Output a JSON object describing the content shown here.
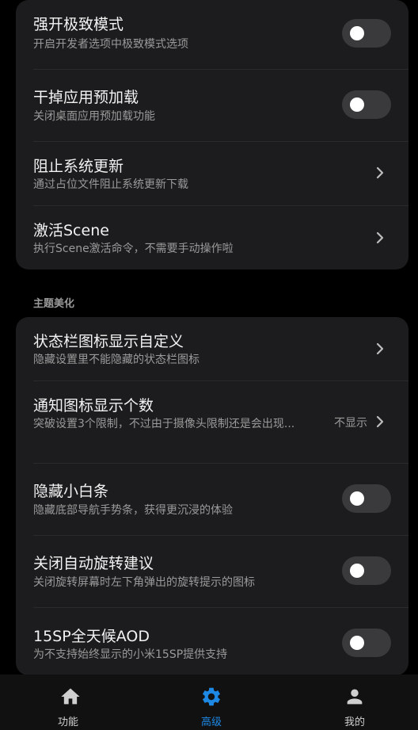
{
  "header_fragment": {
    "title": ""
  },
  "card1": {
    "rows": [
      {
        "title": "强开极致模式",
        "subtitle": "开启开发者选项中极致模式选项",
        "control": "toggle",
        "on": false
      },
      {
        "title": "干掉应用预加载",
        "subtitle": "关闭桌面应用预加载功能",
        "control": "toggle",
        "on": false
      },
      {
        "title": "阻止系统更新",
        "subtitle": "通过占位文件阻止系统更新下载",
        "control": "chevron"
      },
      {
        "title": "激活Scene",
        "subtitle": "执行Scene激活命令，不需要手动操作啦",
        "control": "chevron"
      }
    ]
  },
  "section_theme": {
    "label": "主题美化"
  },
  "card2": {
    "rows": [
      {
        "title": "状态栏图标显示自定义",
        "subtitle": "隐藏设置里不能隐藏的状态栏图标",
        "control": "chevron"
      },
      {
        "title": "通知图标显示个数",
        "subtitle": "突破设置3个限制，不过由于摄像头限制还是会出现...",
        "control": "chevron",
        "value": "不显示"
      },
      {
        "title": "隐藏小白条",
        "subtitle": "隐藏底部导航手势条，获得更沉浸的体验",
        "control": "toggle",
        "on": false
      },
      {
        "title": "关闭自动旋转建议",
        "subtitle": "关闭旋转屏幕时左下角弹出的旋转提示的图标",
        "control": "toggle",
        "on": false
      },
      {
        "title": "15SP全天候AOD",
        "subtitle": "为不支持始终显示的小米15SP提供支持",
        "control": "toggle",
        "on": false
      }
    ]
  },
  "bottom_nav": {
    "tabs": [
      {
        "label": "功能",
        "icon": "home-icon",
        "active": false
      },
      {
        "label": "高级",
        "icon": "gear-icon",
        "active": true
      },
      {
        "label": "我的",
        "icon": "person-icon",
        "active": false
      }
    ],
    "active_color": "#1e88e5",
    "inactive_color": "#cfcfcf"
  }
}
